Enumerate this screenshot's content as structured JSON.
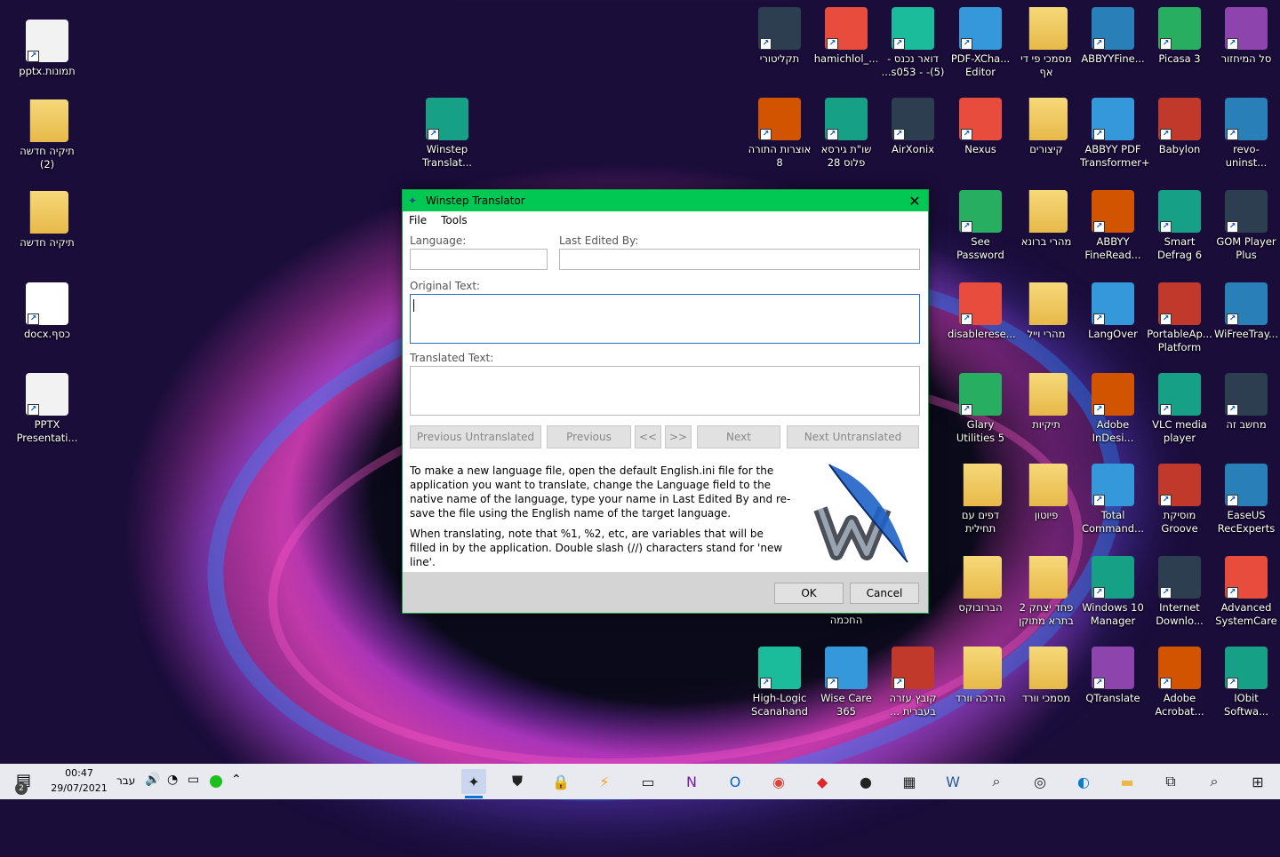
{
  "desktop_icons": [
    {
      "name": "pptx-thumb-icon",
      "label": "תמונות.pptx",
      "kind": "pptx"
    },
    {
      "name": "folder-new-2-icon",
      "label": "תיקיה חדשה (2)",
      "kind": "folder"
    },
    {
      "name": "folder-new-icon",
      "label": "תיקיה חדשה",
      "kind": "folder"
    },
    {
      "name": "docx-file-icon",
      "label": "כסף.docx",
      "kind": "docx"
    },
    {
      "name": "pptx-presentation-icon",
      "label": "PPTX Presentati...",
      "kind": "pptx"
    },
    {
      "name": "winstep-translator-icon",
      "label": "Winstep Translat...",
      "kind": "app"
    },
    {
      "name": "taklitori-icon",
      "label": "תקליטורי",
      "kind": "app"
    },
    {
      "name": "hamichlol-icon",
      "label": "hamichlol_...",
      "kind": "app"
    },
    {
      "name": "edge-mail-icon",
      "label": "דואר נכנס -(5)- - s053...",
      "kind": "app"
    },
    {
      "name": "pdf-xchange-icon",
      "label": "PDF-XCha... Editor",
      "kind": "app"
    },
    {
      "name": "docs-pdf-folder-icon",
      "label": "מסמכי פי די אף",
      "kind": "folder"
    },
    {
      "name": "abbyy-fine-icon",
      "label": "ABBYYFine...",
      "kind": "app"
    },
    {
      "name": "picasa-icon",
      "label": "Picasa 3",
      "kind": "app"
    },
    {
      "name": "recycle-bin-icon",
      "label": "סל המיחזור",
      "kind": "app"
    },
    {
      "name": "otzar-torah-icon",
      "label": "אוצרות התורה 8",
      "kind": "app"
    },
    {
      "name": "shut-icon",
      "label": "שו\"ת גירסא פלוס 28",
      "kind": "app"
    },
    {
      "name": "airxonix-icon",
      "label": "AirXonix",
      "kind": "app"
    },
    {
      "name": "nexus-icon",
      "label": "Nexus",
      "kind": "app"
    },
    {
      "name": "shortcuts-folder-icon",
      "label": "קיצורים",
      "kind": "folder"
    },
    {
      "name": "abbyy-transformer-icon",
      "label": "ABBYY PDF Transformer+",
      "kind": "app"
    },
    {
      "name": "babylon-icon",
      "label": "Babylon",
      "kind": "app"
    },
    {
      "name": "revo-uninstaller-icon",
      "label": "revo-uninst...",
      "kind": "app"
    },
    {
      "name": "see-password-icon",
      "label": "See Password",
      "kind": "app"
    },
    {
      "name": "mahari-brona-folder-icon",
      "label": "מהרי ברונא",
      "kind": "folder"
    },
    {
      "name": "abbyy-fineread-icon",
      "label": "ABBYY FineRead...",
      "kind": "app"
    },
    {
      "name": "smart-defrag-icon",
      "label": "Smart Defrag 6",
      "kind": "app"
    },
    {
      "name": "gom-player-icon",
      "label": "GOM Player Plus",
      "kind": "app"
    },
    {
      "name": "disablerese-icon",
      "label": "disablerese...",
      "kind": "app"
    },
    {
      "name": "mahari-weil-folder-icon",
      "label": "מהרי וייל",
      "kind": "folder"
    },
    {
      "name": "langover-icon",
      "label": "LangOver",
      "kind": "app"
    },
    {
      "name": "portableapps-icon",
      "label": "PortableAp... Platform",
      "kind": "app"
    },
    {
      "name": "wifreetray-icon",
      "label": "WiFreeTray...",
      "kind": "app"
    },
    {
      "name": "glary-utilities-icon",
      "label": "Glary Utilities 5",
      "kind": "app"
    },
    {
      "name": "folders-folder-icon",
      "label": "תיקיות",
      "kind": "folder"
    },
    {
      "name": "adobe-indesign-icon",
      "label": "Adobe InDesi...",
      "kind": "app"
    },
    {
      "name": "vlc-icon",
      "label": "VLC media player",
      "kind": "app"
    },
    {
      "name": "this-pc-icon",
      "label": "מחשב זה",
      "kind": "app"
    },
    {
      "name": "pages-folder-icon",
      "label": "דפים עם תחילית",
      "kind": "folder"
    },
    {
      "name": "piyut-folder-icon",
      "label": "פיוטון",
      "kind": "folder"
    },
    {
      "name": "total-commander-icon",
      "label": "Total Command...",
      "kind": "app"
    },
    {
      "name": "groove-music-icon",
      "label": "מוסיקת Groove",
      "kind": "app"
    },
    {
      "name": "easeus-icon",
      "label": "EaseUS RecExperts",
      "kind": "app"
    },
    {
      "name": "chochma-label-icon",
      "label": "החכמה",
      "kind": "app"
    },
    {
      "name": "habruboks-folder-icon",
      "label": "הברובוקס",
      "kind": "folder"
    },
    {
      "name": "pachad-yitzchak-folder-icon",
      "label": "פחד יצחק 2 בתרא מתוקן",
      "kind": "folder"
    },
    {
      "name": "windows10-manager-icon",
      "label": "Windows 10 Manager",
      "kind": "app"
    },
    {
      "name": "internet-download-icon",
      "label": "Internet Downlo...",
      "kind": "app"
    },
    {
      "name": "advanced-systemcare-icon",
      "label": "Advanced SystemCare",
      "kind": "app"
    },
    {
      "name": "high-logic-icon",
      "label": "High-Logic Scanahand",
      "kind": "app"
    },
    {
      "name": "wise-care-icon",
      "label": "Wise Care 365",
      "kind": "app"
    },
    {
      "name": "help-file-icon",
      "label": "קובץ עזרה בעברית ...",
      "kind": "app"
    },
    {
      "name": "word-guide-folder-icon",
      "label": "הדרכה וורד",
      "kind": "folder"
    },
    {
      "name": "word-docs-folder-icon",
      "label": "מסמכי וורד",
      "kind": "folder"
    },
    {
      "name": "qtranslate-icon",
      "label": "QTranslate",
      "kind": "app"
    },
    {
      "name": "adobe-acrobat-icon",
      "label": "Adobe Acrobat...",
      "kind": "app"
    },
    {
      "name": "iobit-icon",
      "label": "IObit Softwa...",
      "kind": "app"
    }
  ],
  "dialog": {
    "title": "Winstep Translator",
    "menu": [
      "File",
      "Tools"
    ],
    "language_label": "Language:",
    "language_value": "",
    "last_edited_label": "Last Edited By:",
    "last_edited_value": "",
    "original_label": "Original Text:",
    "original_value": "",
    "translated_label": "Translated Text:",
    "translated_value": "",
    "buttons": {
      "prev_untranslated": "Previous Untranslated",
      "previous": "Previous",
      "rewind": "<<",
      "forward": ">>",
      "next": "Next",
      "next_untranslated": "Next Untranslated"
    },
    "help1": "To make a new language file, open the default English.ini file for the application you want to translate, change the Language field to the native name of the language, type your name in Last Edited By and re-save the file using the English name of the target language.",
    "help2": "When translating, note that %1, %2, etc, are variables that will be filled in by the application. Double slash (//) characters stand for 'new line'.",
    "ok": "OK",
    "cancel": "Cancel"
  },
  "taskbar": {
    "notification_count": "2",
    "time": "00:47",
    "date": "29/07/2021",
    "language": "עבר",
    "apps": [
      "winstep",
      "security",
      "keepass",
      "winamp",
      "window",
      "onenote",
      "outlook",
      "chrome",
      "anydesk",
      "chat",
      "news",
      "word",
      "magnifier",
      "search-app",
      "edge",
      "explorer",
      "taskview",
      "search",
      "start"
    ]
  },
  "colors": {
    "titlebar": "#00c853",
    "accent": "#0078d4"
  }
}
